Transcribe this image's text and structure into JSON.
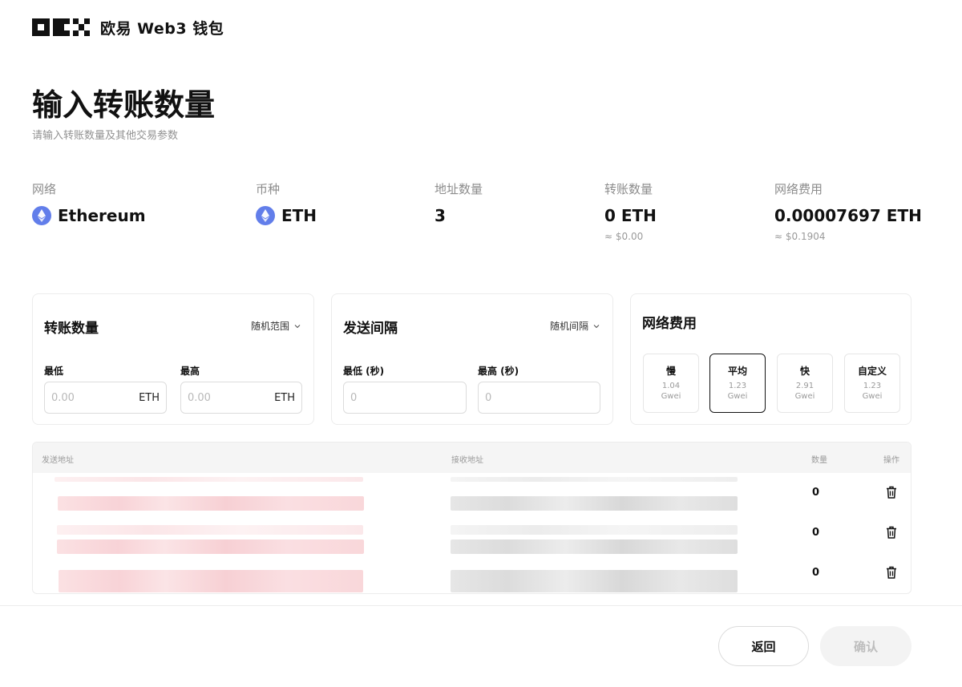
{
  "header": {
    "brand": "欧易 Web3 钱包"
  },
  "page": {
    "title": "输入转账数量",
    "subtitle": "请输入转账数量及其他交易参数"
  },
  "summary": {
    "network": {
      "label": "网络",
      "value": "Ethereum",
      "icon": "ethereum-icon"
    },
    "token": {
      "label": "币种",
      "value": "ETH",
      "icon": "ethereum-icon"
    },
    "address_count": {
      "label": "地址数量",
      "value": "3"
    },
    "transfer_amount": {
      "label": "转账数量",
      "value": "0 ETH",
      "sub": "≈ $0.00"
    },
    "network_fee": {
      "label": "网络费用",
      "value": "0.00007697 ETH",
      "sub": "≈ $0.1904"
    }
  },
  "amount_card": {
    "title": "转账数量",
    "mode": "随机范围",
    "min_label": "最低",
    "max_label": "最高",
    "min_placeholder": "0.00",
    "max_placeholder": "0.00",
    "unit": "ETH"
  },
  "interval_card": {
    "title": "发送间隔",
    "mode": "随机间隔",
    "min_label": "最低 (秒)",
    "max_label": "最高 (秒)",
    "min_placeholder": "0",
    "max_placeholder": "0"
  },
  "fee_card": {
    "title": "网络费用",
    "selected": "平均",
    "options": [
      {
        "name": "慢",
        "value": "1.04",
        "unit": "Gwei"
      },
      {
        "name": "平均",
        "value": "1.23",
        "unit": "Gwei"
      },
      {
        "name": "快",
        "value": "2.91",
        "unit": "Gwei"
      },
      {
        "name": "自定义",
        "value": "1.23",
        "unit": "Gwei"
      }
    ]
  },
  "table": {
    "columns": [
      "发送地址",
      "接收地址",
      "数量",
      "操作"
    ],
    "rows": [
      {
        "quantity": "0"
      },
      {
        "quantity": "0"
      },
      {
        "quantity": "0"
      }
    ]
  },
  "footer": {
    "back_label": "返回",
    "confirm_label": "确认"
  },
  "colors": {
    "ethereum_accent": "#627EEA",
    "active_border": "#111111",
    "disabled_bg": "#F3F3F3",
    "muted_text": "#9A9A9A"
  }
}
